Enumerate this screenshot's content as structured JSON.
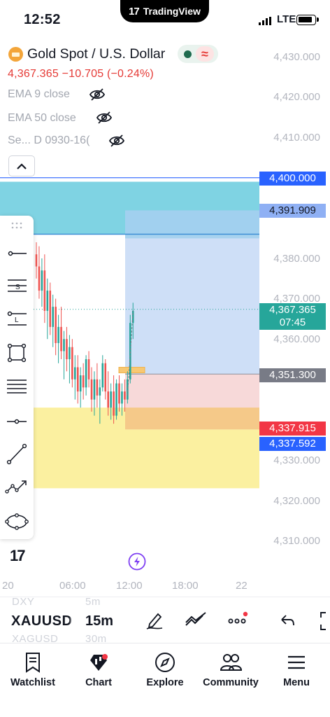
{
  "status_bar": {
    "time": "12:52",
    "island_brand": "TradingView",
    "network": "LTE"
  },
  "header": {
    "symbol_title": "Gold Spot / U.S. Dollar",
    "price_change": "4,367.365 −10.705 (−0.24%)",
    "market_status_glyph": "≈",
    "indicators": [
      {
        "label": "EMA 9 close"
      },
      {
        "label": "EMA 50 close"
      },
      {
        "label": "Se... D 0930-16("
      }
    ]
  },
  "price_axis": {
    "ticks": [
      "4,430.000",
      "4,420.000",
      "4,410.000",
      "4,380.000",
      "4,370.000",
      "4,360.000",
      "4,330.000",
      "4,320.000",
      "4,310.000"
    ],
    "tags": {
      "level_blue": "4,400.000",
      "level_light": "4,391.909",
      "last_price": "4,367.365",
      "countdown": "07:45",
      "entry": "4,351.300",
      "bid": "4,337.915",
      "ask": "4,337.592"
    }
  },
  "time_axis": {
    "ticks": [
      "20",
      "06:00",
      "12:00",
      "18:00",
      "22"
    ]
  },
  "chart_data": {
    "type": "candlestick",
    "symbol": "XAUUSD",
    "interval": "15m",
    "ylim": [
      4305,
      4435
    ],
    "last_price": 4367.365,
    "x_ticks": [
      "20",
      "06:00",
      "12:00",
      "18:00",
      "22"
    ],
    "horizontal_levels": [
      4400.0,
      4391.909,
      4351.3,
      4337.915,
      4337.592
    ],
    "zones": [
      {
        "name": "cyan zone",
        "from": 4386,
        "to": 4399,
        "color": "#7fd3e3"
      },
      {
        "name": "yellow zone",
        "from": 4323,
        "to": 4343,
        "color": "#fbf0a0"
      },
      {
        "name": "position target",
        "from": 4351.3,
        "to": 4391.9,
        "color": "#c9dbf6"
      },
      {
        "name": "position stop",
        "from": 4337.6,
        "to": 4351.3,
        "color": "#f6d2d2"
      }
    ],
    "candles": [
      [
        4381,
        4384,
        4375,
        4378
      ],
      [
        4378,
        4383,
        4370,
        4372
      ],
      [
        4372,
        4380,
        4368,
        4377
      ],
      [
        4377,
        4381,
        4364,
        4367
      ],
      [
        4367,
        4375,
        4360,
        4372
      ],
      [
        4372,
        4374,
        4361,
        4363
      ],
      [
        4363,
        4371,
        4358,
        4368
      ],
      [
        4368,
        4370,
        4356,
        4359
      ],
      [
        4359,
        4366,
        4354,
        4363
      ],
      [
        4363,
        4368,
        4355,
        4357
      ],
      [
        4357,
        4362,
        4350,
        4360
      ],
      [
        4360,
        4363,
        4352,
        4355
      ],
      [
        4355,
        4361,
        4349,
        4358
      ],
      [
        4358,
        4360,
        4348,
        4350
      ],
      [
        4350,
        4356,
        4345,
        4353
      ],
      [
        4353,
        4356,
        4344,
        4347
      ],
      [
        4347,
        4353,
        4343,
        4351
      ],
      [
        4351,
        4354,
        4345,
        4348
      ],
      [
        4348,
        4356,
        4346,
        4355
      ],
      [
        4355,
        4357,
        4348,
        4350
      ],
      [
        4350,
        4353,
        4342,
        4345
      ],
      [
        4345,
        4352,
        4341,
        4350
      ],
      [
        4350,
        4354,
        4343,
        4346
      ],
      [
        4346,
        4350,
        4339,
        4348
      ],
      [
        4348,
        4356,
        4347,
        4354
      ],
      [
        4354,
        4355,
        4345,
        4347
      ],
      [
        4347,
        4352,
        4341,
        4343
      ],
      [
        4343,
        4349,
        4340,
        4347
      ],
      [
        4347,
        4351,
        4339,
        4341
      ],
      [
        4341,
        4350,
        4340,
        4349
      ],
      [
        4349,
        4351,
        4342,
        4344
      ],
      [
        4344,
        4349,
        4341,
        4347
      ],
      [
        4347,
        4350,
        4342,
        4345
      ],
      [
        4345,
        4352,
        4344,
        4350
      ],
      [
        4350,
        4366,
        4349,
        4364
      ],
      [
        4364,
        4369,
        4360,
        4367
      ]
    ],
    "colors": {
      "up": "#26a69a",
      "down": "#ef5350",
      "level_blue": "#2962ff",
      "price_tag_green": "#26a69a",
      "price_tag_red": "#f23645",
      "entry_tag": "#787b86"
    }
  },
  "bottom_bar": {
    "symbol": "XAUUSD",
    "interval": "15m",
    "ghost_prev_symbol": "DXY",
    "ghost_prev_interval": "5m",
    "ghost_next_symbol": "XAGUSD",
    "ghost_next_interval": "30m"
  },
  "tabs": [
    {
      "label": "Watchlist",
      "icon": "watchlist-icon"
    },
    {
      "label": "Chart",
      "icon": "chart-icon"
    },
    {
      "label": "Explore",
      "icon": "compass-icon"
    },
    {
      "label": "Community",
      "icon": "community-icon"
    },
    {
      "label": "Menu",
      "icon": "menu-icon"
    }
  ]
}
